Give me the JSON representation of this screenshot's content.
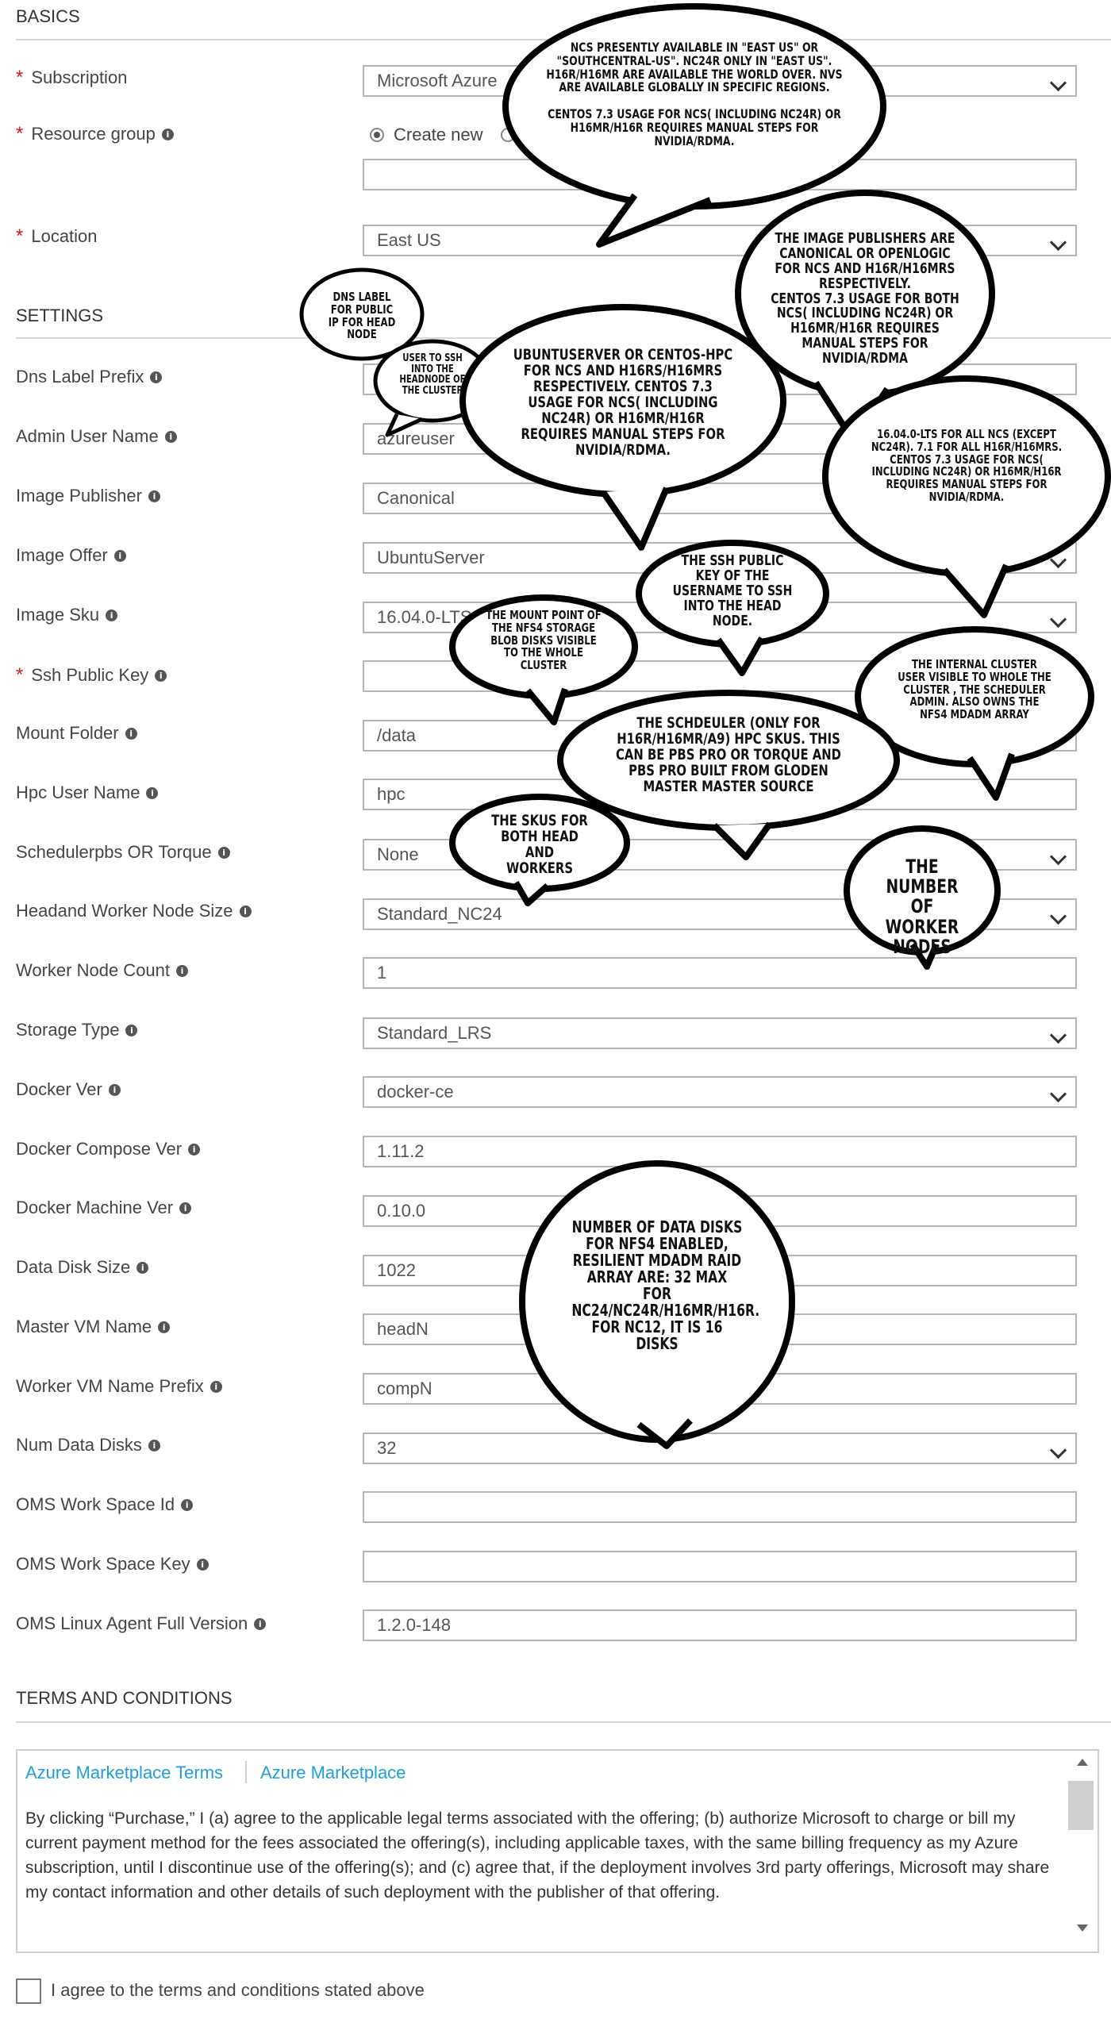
{
  "sections": {
    "basics": "BASICS",
    "settings": "SETTINGS",
    "terms": "TERMS AND CONDITIONS"
  },
  "fields": {
    "subscription": {
      "label": "Subscription",
      "value": "Microsoft Azure"
    },
    "resource_group": {
      "label": "Resource group",
      "option_create": "Create new",
      "value": ""
    },
    "location": {
      "label": "Location",
      "value": "East US"
    },
    "dns_label_prefix": {
      "label": "Dns Label Prefix",
      "value": ""
    },
    "admin_user_name": {
      "label": "Admin User Name",
      "value": "azureuser"
    },
    "image_publisher": {
      "label": "Image Publisher",
      "value": "Canonical"
    },
    "image_offer": {
      "label": "Image Offer",
      "value": "UbuntuServer"
    },
    "image_sku": {
      "label": "Image Sku",
      "value": "16.04.0-LTS"
    },
    "ssh_public_key": {
      "label": "Ssh Public Key",
      "value": ""
    },
    "mount_folder": {
      "label": "Mount Folder",
      "value": "/data"
    },
    "hpc_user_name": {
      "label": "Hpc User Name",
      "value": "hpc"
    },
    "scheduler": {
      "label": "Schedulerpbs OR Torque",
      "value": "None"
    },
    "node_size": {
      "label": "Headand Worker Node Size",
      "value": "Standard_NC24"
    },
    "worker_node_count": {
      "label": "Worker Node Count",
      "value": "1"
    },
    "storage_type": {
      "label": "Storage Type",
      "value": "Standard_LRS"
    },
    "docker_ver": {
      "label": "Docker Ver",
      "value": "docker-ce"
    },
    "docker_compose_ver": {
      "label": "Docker Compose Ver",
      "value": "1.11.2"
    },
    "docker_machine_ver": {
      "label": "Docker Machine Ver",
      "value": "0.10.0"
    },
    "data_disk_size": {
      "label": "Data Disk Size",
      "value": "1022"
    },
    "master_vm_name": {
      "label": "Master VM Name",
      "value": "headN"
    },
    "worker_vm_name_prefix": {
      "label": "Worker VM Name Prefix",
      "value": "compN"
    },
    "num_data_disks": {
      "label": "Num Data Disks",
      "value": "32"
    },
    "oms_workspace_id": {
      "label": "OMS Work Space Id",
      "value": ""
    },
    "oms_workspace_key": {
      "label": "OMS Work Space Key",
      "value": ""
    },
    "oms_agent_version": {
      "label": "OMS Linux Agent Full Version",
      "value": "1.2.0-148"
    }
  },
  "terms": {
    "link1": "Azure Marketplace Terms",
    "link2": "Azure Marketplace",
    "text": "By clicking “Purchase,” I (a) agree to the applicable legal terms associated with the offering; (b) authorize Microsoft to charge or bill my current payment method for the fees associated the offering(s), including applicable taxes, with the same billing frequency as my Azure subscription, until I discontinue use of the offering(s); and (c) agree that, if the deployment involves 3rd party offerings, Microsoft may share my contact information and other details of such deployment with the publisher of that offering.",
    "agree_label": "I agree to the terms and conditions stated above"
  },
  "annotations": {
    "location": "NCs presently available in \"East US\" or \"SouthCentral-US\". NC24R only in \"East US\". H16R/H16MR are available the world over. NVs are available globally in specific regions.\n\nCentOS 7.3 usage for NCs( including NC24R) or H16MR/H16R requires manual steps for NVIDIA/RDMA.",
    "publisher": "The image publishers are Canonical or OpenLogic for NCs and H16R/H16MRs respectively.\nCentOS 7.3 usage for both NCs( including NC24R) or H16MR/H16R requires manual steps for NVIDIA/RDMA",
    "dns": "DNS label for public IP for head node",
    "user": "User to SSH into the headnode of the cluster",
    "offer": "UbuntuServer or CentOS-HPC for NCs and H16Rs/H16MRs respectively. CentOS 7.3 usage for NCs( including NC24R) or H16MR/H16R requires manual steps for NVIDIA/RDMA.",
    "sku": "16.04.0-LTS for all NCs (except NC24R). 7.1 for all H16R/H16MRs. CentOS 7.3 usage for NCs( including NC24R) or H16MR/H16R requires manual steps for NVIDIA/RDMA.",
    "ssh": "The SSH public key of the username to SSH into the head node.",
    "mount": "The mount point of the NFS4 storage blob disks visible to the whole cluster",
    "hpc_user": "The internal cluster user visible to whole the cluster , the scheduler admin. Also owns the NFS4 mdadm array",
    "scheduler": "The schdeuler (only for H16R/H16MR/A9) HPC SKUs. This can be PBS Pro or Torque and PBS Pro built from Gloden Master master source",
    "skus": "The SKUs for both head and workers",
    "workers": "The number of worker nodes",
    "disks": "Number of data disks for NFS4 enabled, resilient mdadm raid array are: 32 max for NC24/NC24R/H16MR/H16R. For NC12, it is 16 disks"
  },
  "icons": {
    "info": "info-icon",
    "dropdown": "chevron-down-icon",
    "required": "asterisk"
  },
  "colors": {
    "required": "#d11b1b",
    "link": "#1f9fd6",
    "border": "#b5b5b5"
  }
}
